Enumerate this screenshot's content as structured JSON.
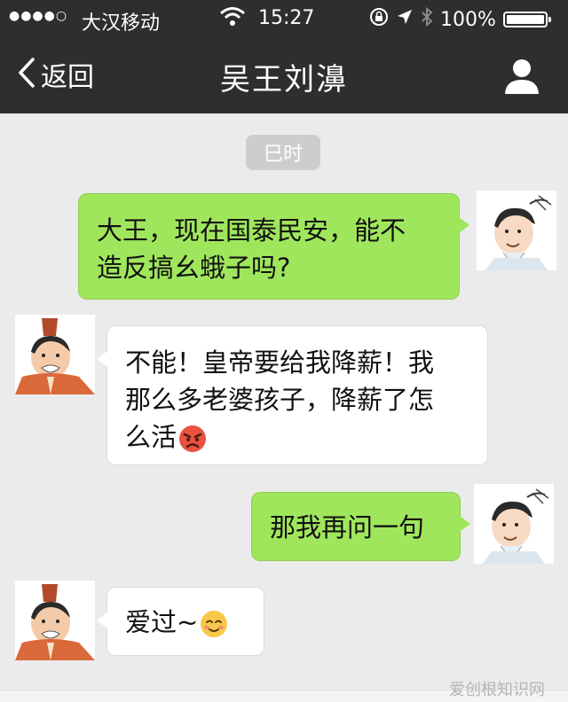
{
  "status_bar": {
    "signal": "●●●●○",
    "carrier": "大汉移动",
    "time": "15:27",
    "battery": "100%"
  },
  "navbar": {
    "back_label": "返回",
    "title": "吴王刘濞"
  },
  "chat": {
    "timestamp": "巳时",
    "messages": [
      {
        "side": "sent",
        "lines": [
          "大王，现在国泰民安，能不",
          "造反搞幺蛾子吗?"
        ]
      },
      {
        "side": "received",
        "lines": [
          "不能！皇帝要给我降薪！我",
          "那么多老婆孩子，降薪了怎",
          "么活"
        ],
        "emoji": "angry-face-emoji"
      },
      {
        "side": "sent",
        "lines": [
          "那我再问一句"
        ]
      },
      {
        "side": "received",
        "lines": [
          "爱过~"
        ],
        "emoji": "smiling-blush-emoji"
      }
    ]
  },
  "watermark": "爱创根知识网",
  "colors": {
    "bar": "#2e2e30",
    "background": "#ebebeb",
    "sent_bubble": "#a0e65c",
    "received_bubble": "#ffffff"
  }
}
